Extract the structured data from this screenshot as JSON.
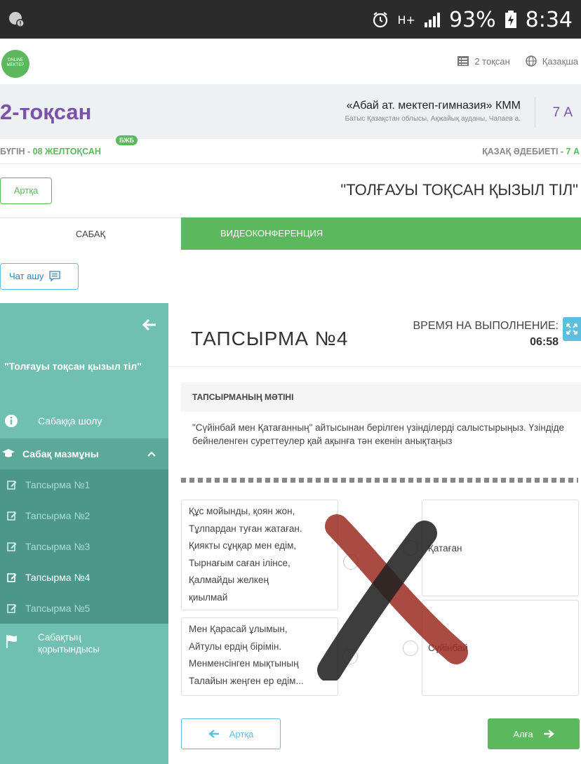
{
  "status_bar": {
    "network": "H+",
    "battery": "93%",
    "time": "8:34"
  },
  "header": {
    "logo_text": "ONLINE MEKTEP",
    "quarter_link": "2 тоқсан",
    "language": "Қазақша"
  },
  "title_band": {
    "quarter": "2-тоқсан",
    "school_name": "«Абай ат. мектеп-гимназия» КММ",
    "school_address": "Батыс Қазақстан облысы, Ақжайық ауданы, Чапаев а.",
    "class": "7 А"
  },
  "date_band": {
    "today_prefix": "БҮГІН - ",
    "today_date": "08 ЖЕЛТОҚСАН",
    "badge": "БЖБ",
    "subject_prefix": "ҚАЗАҚ ӘДЕБИЕТІ - ",
    "subject_class": "7 А"
  },
  "lesson": {
    "back_label": "Артқа",
    "title": "\"ТОЛҒАУЫ ТОҚСАН ҚЫЗЫЛ ТІЛ\""
  },
  "tabs": {
    "lesson": "САБАҚ",
    "video": "ВИДЕОКОНФЕРЕНЦИЯ"
  },
  "chat": {
    "label": "Чат ашу"
  },
  "sidebar": {
    "lesson_title": "\"Толғауы тоқсан қызыл тіл\"",
    "overview": "Сабаққа шолу",
    "content": "Сабақ мазмұны",
    "tasks": [
      "Тапсырма №1",
      "Тапсырма №2",
      "Тапсырма №3",
      "Тапсырма №4",
      "Тапсырма №5"
    ],
    "active_task_index": 3,
    "summary_line1": "Сабақтың",
    "summary_line2": "қорытындысы"
  },
  "main": {
    "task_title": "ТАПСЫРМА №4",
    "timer_label": "ВРЕМЯ НА ВЫПОЛНЕНИЕ:",
    "timer_value": "06:58",
    "text_heading": "ТАПСЫРМАНЫҢ МӘТІНІ",
    "task_text": "\"Сүйінбай мен Қатағанның\" айтысынан берілген үзінділерді салыстырыңыз. Үзіндіде бейнеленген суреттеулер қай ақынға тән екенін анықтаңыз",
    "quotes": [
      [
        "Құс мойынды, қоян жон,",
        "Тұлпардан туған жатаған.",
        "Қиякты сұңқар мен едім,",
        "Тырнағым саған ілінсе,",
        "Қалмайды желкең",
        "қиылмай"
      ],
      [
        "Мен Қарасай ұлымын,",
        "Айтулы ердің бірімін.",
        "Менменсінген мықтының",
        "Талайын жеңген ер едім..."
      ]
    ],
    "answers": [
      "Қатаған",
      "Сүйінбай"
    ],
    "back_button": "Артқа",
    "next_button": "Алға"
  }
}
